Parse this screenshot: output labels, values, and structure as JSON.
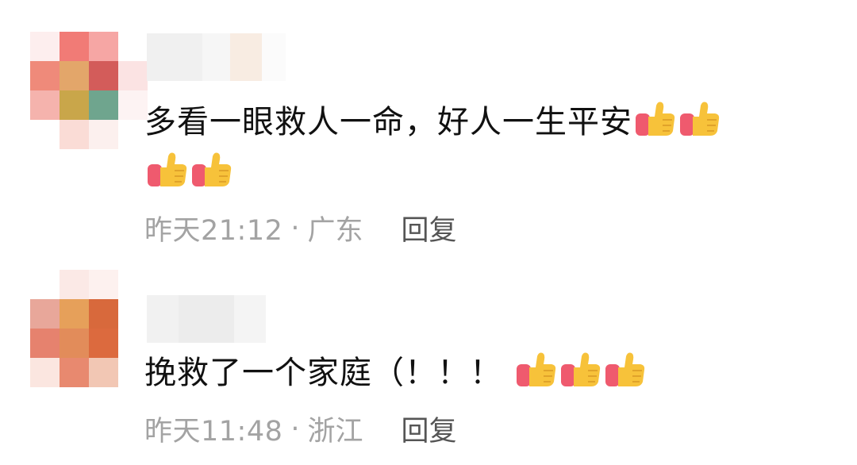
{
  "comments": [
    {
      "text": "多看一眼救人一命，好人一生平安",
      "emoji_name": "thumbs-up",
      "emoji_count": 4,
      "time": "昨天21:12",
      "separator": "·",
      "location": "广东",
      "reply_label": "回复"
    },
    {
      "text": "挽救了一个家庭（！！！",
      "emoji_name": "thumbs-up",
      "emoji_count": 3,
      "time": "昨天11:48",
      "separator": "·",
      "location": "浙江",
      "reply_label": "回复"
    }
  ],
  "colors": {
    "text": "#111111",
    "meta": "#a3a3a3",
    "reply": "#555555",
    "thumb_yellow": "#f7c23a",
    "thumb_cuff": "#ef5a6e"
  }
}
